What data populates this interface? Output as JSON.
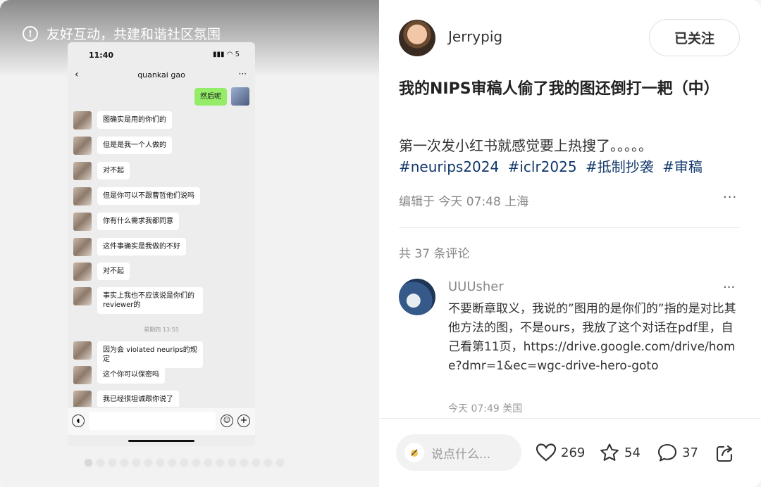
{
  "media": {
    "notice": "友好互动，共建和谐社区氛围",
    "phone": {
      "time": "11:40",
      "signal": "5",
      "chat_name": "quankai gao",
      "my_message": "然后呢",
      "messages": [
        "图确实是用的你们的",
        "但是是我一个人做的",
        "对不起",
        "但是你可以不跟曹哲他们说吗",
        "你有什么需求我都同意",
        "这件事确实是我做的不好",
        "对不起",
        "事实上我也不应该说是你们的reviewer的",
        "因为会 violated neurips的规定",
        "这个你可以保密吗",
        "我已经很坦诚跟你说了"
      ],
      "timestamp": "星期四 13:55"
    }
  },
  "author": {
    "name": "Jerrypig",
    "follow_label": "已关注"
  },
  "post": {
    "title": "我的NIPS审稿人偷了我的图还倒打一耙（中）",
    "desc": "第一次发小红书就感觉要上热搜了。。。。。",
    "tags": [
      "#neurips2024",
      "#iclr2025",
      "#抵制抄袭",
      "#审稿"
    ],
    "meta": "编辑于 今天 07:48 上海"
  },
  "comments": {
    "count": "共 37 条评论",
    "items": [
      {
        "user": "UUUsher",
        "text": "不要断章取义，我说的”图用的是你们的”指的是对比其他方法的图，不是ours，我放了这个对话在pdf里，自己看第11页，https://drive.google.com/drive/home?dmr=1&ec=wgc-drive-hero-goto",
        "time": "今天 07:49 美国"
      }
    ]
  },
  "bottom": {
    "placeholder": "说点什么...",
    "likes": "269",
    "stars": "54",
    "comments": "37"
  }
}
